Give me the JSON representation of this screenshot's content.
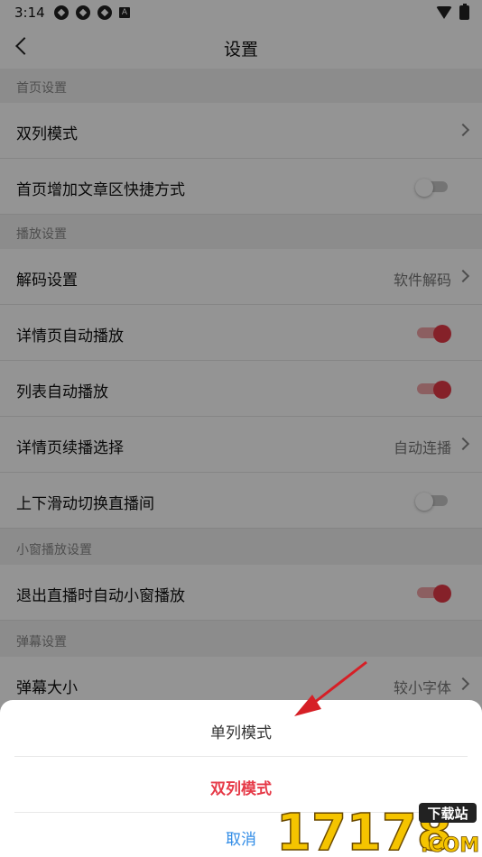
{
  "status_bar": {
    "time": "3:14",
    "badge": "A"
  },
  "header": {
    "title": "设置"
  },
  "sections": {
    "home": "首页设置",
    "play": "播放设置",
    "mini": "小窗播放设置",
    "danmaku": "弹幕设置"
  },
  "rows": {
    "double_column": {
      "label": "双列模式"
    },
    "shortcut": {
      "label": "首页增加文章区快捷方式",
      "toggle": "off"
    },
    "decode": {
      "label": "解码设置",
      "value": "软件解码"
    },
    "detail_autoplay": {
      "label": "详情页自动播放",
      "toggle": "on"
    },
    "list_autoplay": {
      "label": "列表自动播放",
      "toggle": "on"
    },
    "continue_play": {
      "label": "详情页续播选择",
      "value": "自动连播"
    },
    "swipe_live": {
      "label": "上下滑动切换直播间",
      "toggle": "off"
    },
    "exit_live_mini": {
      "label": "退出直播时自动小窗播放",
      "toggle": "on"
    },
    "danmaku_size": {
      "label": "弹幕大小",
      "value": "较小字体"
    }
  },
  "sheet": {
    "option_single": "单列模式",
    "option_double": "双列模式",
    "cancel": "取消"
  },
  "watermark": {
    "number": "17178",
    "site": "下载站",
    "suffix": ".COM"
  },
  "colors": {
    "accent": "#e63a48",
    "link": "#2f8be6",
    "annotation_arrow": "#d61f26"
  }
}
